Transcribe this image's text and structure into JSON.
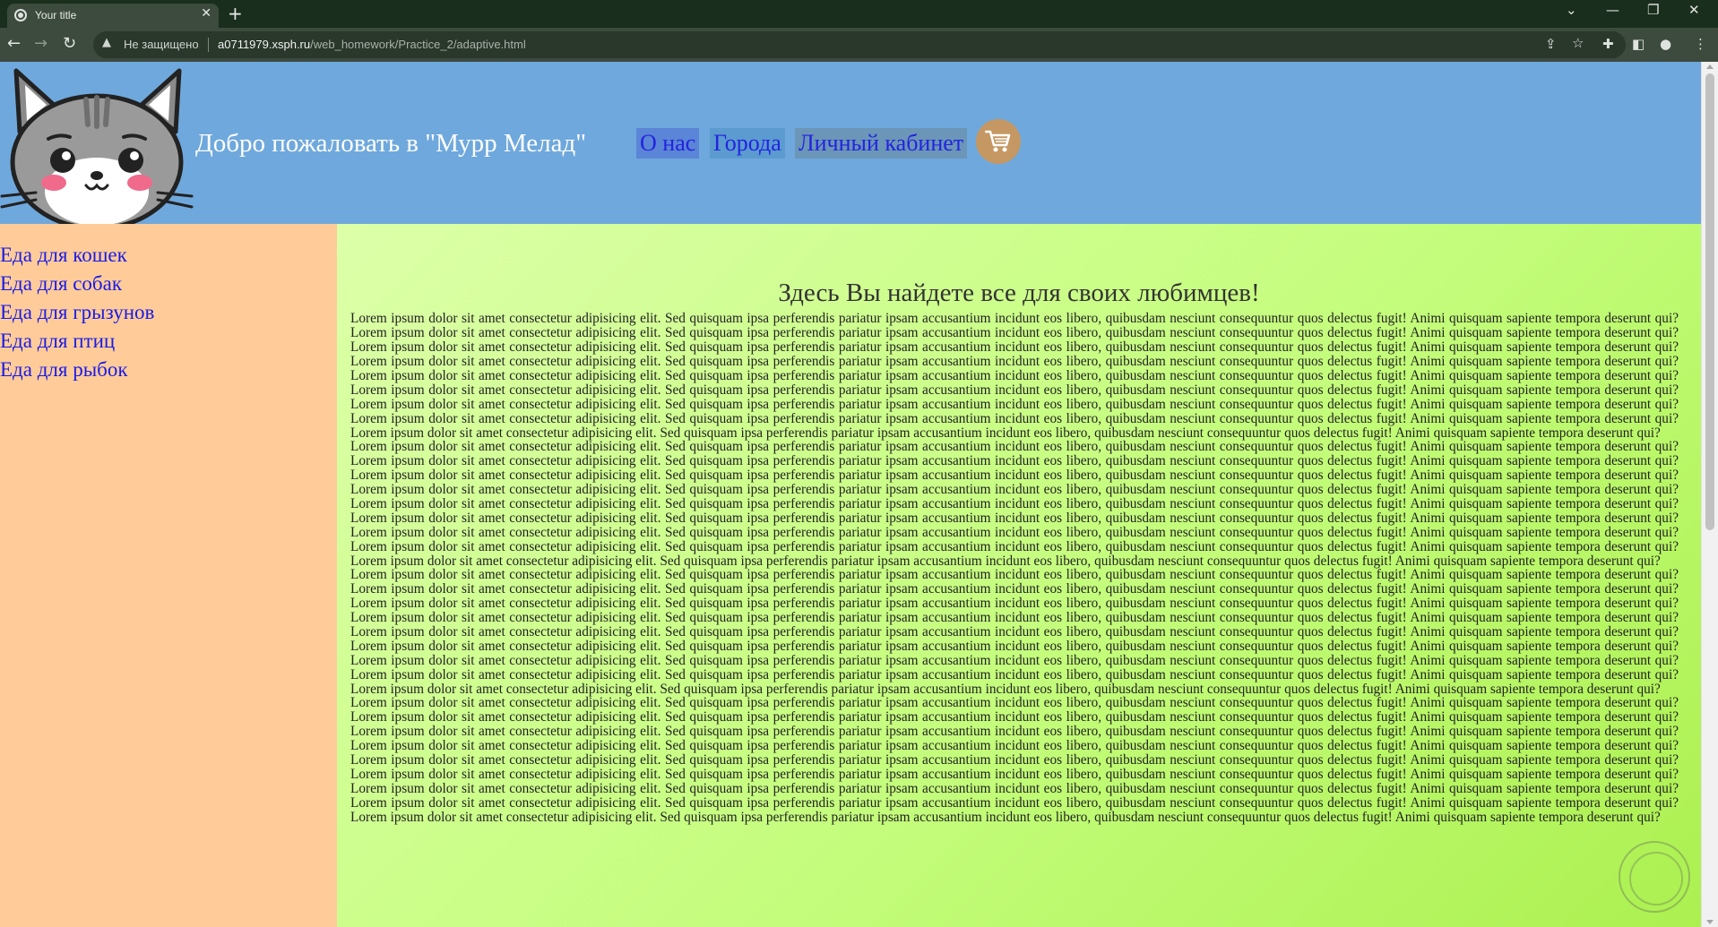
{
  "browser": {
    "tab_title": "Your title",
    "tab_close": "✕",
    "new_tab": "+",
    "insecure_label": "Не защищено",
    "url_host": "a0711979.xsph.ru",
    "url_path": "/web_homework/Practice_2/adaptive.html",
    "icons": [
      "back-arrow-icon",
      "forward-arrow-icon",
      "reload-icon",
      "warning-icon",
      "share-icon",
      "star-icon",
      "extensions-icon",
      "sidepanel-icon",
      "profile-icon",
      "menu-icon",
      "minimize-icon",
      "restore-icon",
      "close-icon",
      "tab-search-icon"
    ]
  },
  "header": {
    "site_title": "Добро пожаловать в \"Мурр Мелад\"",
    "nav": {
      "about": "О нас",
      "cities": "Города",
      "account": "Личный кабинет"
    },
    "logo": "cat-logo",
    "cart_icon": "cart-icon"
  },
  "sidebar": {
    "items": [
      "Еда для кошек",
      "Еда для собак",
      "Еда для грызунов",
      "Еда для птиц",
      "Еда для рыбок"
    ]
  },
  "main": {
    "heading": "Здесь Вы найдете все для своих любимцев!",
    "paragraph": "Lorem ipsum dolor sit amet consectetur adipisicing elit. Sed quisquam ipsa perferendis pariatur ipsam accusantium incidunt eos libero, quibusdam nesciunt consequuntur quos delectus fugit! Animi quisquam sapiente tempora deserunt qui? Lorem ipsum dolor sit amet consectetur adipisicing elit. Sed quisquam ipsa perferendis pariatur ipsam accusantium incidunt eos libero, quibusdam nesciunt consequuntur quos delectus fugit! Animi quisquam sapiente tempora deserunt qui? Lorem ipsum dolor sit amet consectetur adipisicing elit. Sed quisquam ipsa perferendis pariatur ipsam accusantium incidunt eos libero, quibusdam nesciunt consequuntur quos delectus fugit! Animi quisquam sapiente tempora deserunt qui? Lorem ipsum dolor sit amet consectetur adipisicing elit. Sed quisquam ipsa perferendis pariatur ipsam accusantium incidunt eos libero, quibusdam nesciunt consequuntur quos delectus fugit! Animi quisquam sapiente tempora deserunt qui? Lorem ipsum dolor sit amet consectetur adipisicing elit. Sed quisquam ipsa perferendis pariatur ipsam accusantium incidunt eos libero, quibusdam nesciunt consequuntur quos delectus fugit! Animi quisquam sapiente tempora deserunt qui? Lorem ipsum dolor sit amet consectetur adipisicing elit. Sed quisquam ipsa perferendis pariatur ipsam accusantium incidunt eos libero, quibusdam nesciunt consequuntur quos delectus fugit! Animi quisquam sapiente tempora deserunt qui? Lorem ipsum dolor sit amet consectetur adipisicing elit. Sed quisquam ipsa perferendis pariatur ipsam accusantium incidunt eos libero, quibusdam nesciunt consequuntur quos delectus fugit! Animi quisquam sapiente tempora deserunt qui? Lorem ipsum dolor sit amet consectetur adipisicing elit. Sed quisquam ipsa perferendis pariatur ipsam accusantium incidunt eos libero, quibusdam nesciunt consequuntur quos delectus fugit! Animi quisquam sapiente tempora deserunt qui? Lorem ipsum dolor sit amet consectetur adipisicing elit. Sed quisquam ipsa perferendis pariatur ipsam accusantium incidunt eos libero, quibusdam nesciunt consequuntur quos delectus fugit! Animi quisquam sapiente tempora deserunt qui?"
  },
  "colors": {
    "header_bg": "#6fa8dc",
    "sidebar_bg": "#ffcc99",
    "main_bg": "#c4fd7c",
    "link": "#1a1ae6"
  }
}
